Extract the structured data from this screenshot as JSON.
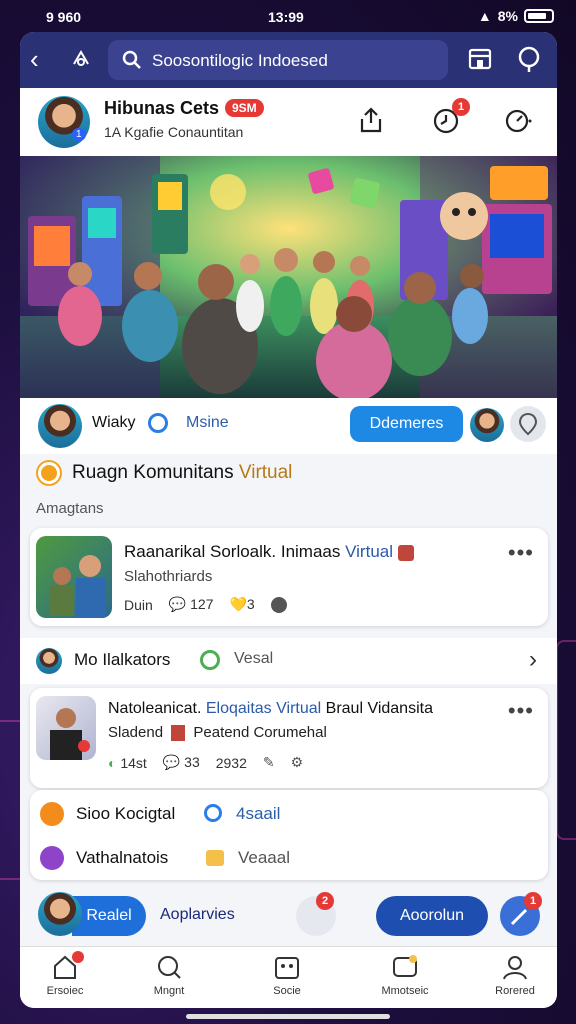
{
  "status_bar": {
    "left": "9 960",
    "time": "13:99",
    "right": "8%"
  },
  "topnav": {
    "search_text": "Soosontilogic Indoesed"
  },
  "profile": {
    "name": "Hibunas Cets",
    "badge": "9SM",
    "subtitle": "1A Kgafie Conauntitan",
    "avatar_num": "1"
  },
  "host": {
    "name": "Wiaky",
    "role": "Msine",
    "follow_label": "Ddemeres"
  },
  "room": {
    "title": "Ruagn Komunitans",
    "title_highlight": "Virtual",
    "section_label": "Amagtans"
  },
  "post1": {
    "title": "Raanarikal Sorloalk. Inimaas",
    "title_highlight": "Virtual",
    "subtitle": "Slahothriards",
    "stats": [
      "Duin",
      "127",
      "3"
    ]
  },
  "row": {
    "label": "Mo Ilalkators",
    "tag": "Vesal"
  },
  "post2": {
    "title": "Natoleanicat.",
    "title_highlight1": "Eloqaitas",
    "title_highlight2": "Virtual",
    "title_tail": "Braul Vidansita",
    "subtitle": "Sladend",
    "subtitle2": "Peatend Corumehal",
    "stats": [
      "14st",
      "33",
      "2932"
    ]
  },
  "mini": [
    {
      "label": "Sioo Kocigtal",
      "extra": "4saail",
      "color": "#f48c1b"
    },
    {
      "label": "Vathalnatois",
      "extra": "Veaaal",
      "color": "#8e44c9"
    }
  ],
  "actions": {
    "read_label": "Realel",
    "apps_label": "Aoplarvies",
    "accept_label": "Aoorolun",
    "badge1": "2",
    "badge2": "1"
  },
  "tabs": [
    {
      "label": "Ersoiec",
      "icon": "home-icon"
    },
    {
      "label": "Mngnt",
      "icon": "search-icon"
    },
    {
      "label": "Socie",
      "icon": "social-icon"
    },
    {
      "label": "Mmotseic",
      "icon": "message-icon"
    },
    {
      "label": "Rorered",
      "icon": "profile-icon"
    }
  ],
  "colors": {
    "nav": "#2a3175",
    "accent": "#1e88e5",
    "badge": "#e53935"
  }
}
